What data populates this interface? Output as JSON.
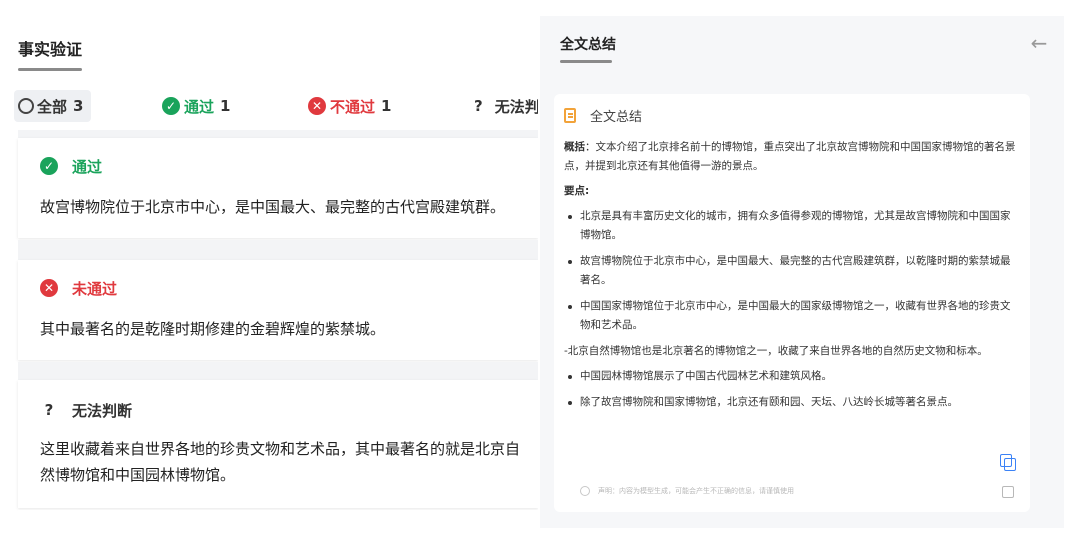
{
  "left": {
    "title": "事实验证",
    "filters": {
      "all": {
        "label": "全部",
        "count": "3"
      },
      "pass": {
        "label": "通过",
        "count": "1"
      },
      "fail": {
        "label": "不通过",
        "count": "1"
      },
      "unknown": {
        "label": "无法判",
        "symbol": "?"
      }
    },
    "cards": [
      {
        "status": "通过",
        "text": "故宫博物院位于北京市中心，是中国最大、最完整的古代宫殿建筑群。"
      },
      {
        "status": "未通过",
        "text": "其中最著名的是乾隆时期修建的金碧辉煌的紫禁城。"
      },
      {
        "status": "无法判断",
        "symbol": "?",
        "line1": "这里收藏着来自世界各地的珍贵文物和艺术品，其中最著名的就是北京自",
        "line2": "然博物馆和中国园林博物馆。"
      }
    ]
  },
  "right": {
    "title": "全文总结",
    "back_icon": "arrow-left",
    "card_title": "全文总结",
    "overview_label": "概括",
    "overview_text": "：文本介绍了北京排名前十的博物馆，重点突出了北京故宫博物院和中国国家博物馆的著名景点，并提到北京还有其他值得一游的景点。",
    "points_label": "要点:",
    "points_a": [
      "北京是具有丰富历史文化的城市，拥有众多值得参观的博物馆，尤其是故宫博物院和中国国家博物馆。",
      "故宫博物院位于北京市中心，是中国最大、最完整的古代宫殿建筑群，以乾隆时期的紫禁城最著名。",
      "中国国家博物馆位于北京市中心，是中国最大的国家级博物馆之一，收藏有世界各地的珍贵文物和艺术品。"
    ],
    "middle_text": "-北京自然博物馆也是北京著名的博物馆之一，收藏了来自世界各地的自然历史文物和标本。",
    "points_b": [
      "中国园林博物馆展示了中国古代园林艺术和建筑风格。",
      "除了故宫博物院和国家博物馆，北京还有颐和园、天坛、八达岭长城等著名景点。"
    ],
    "disclaimer": "声明：内容为模型生成，可能会产生不正确的信息，请谨慎使用"
  },
  "colors": {
    "pass": "#1aa35b",
    "fail": "#e0393e",
    "accent": "#3b82f6",
    "doc_icon": "#f2a33a"
  }
}
